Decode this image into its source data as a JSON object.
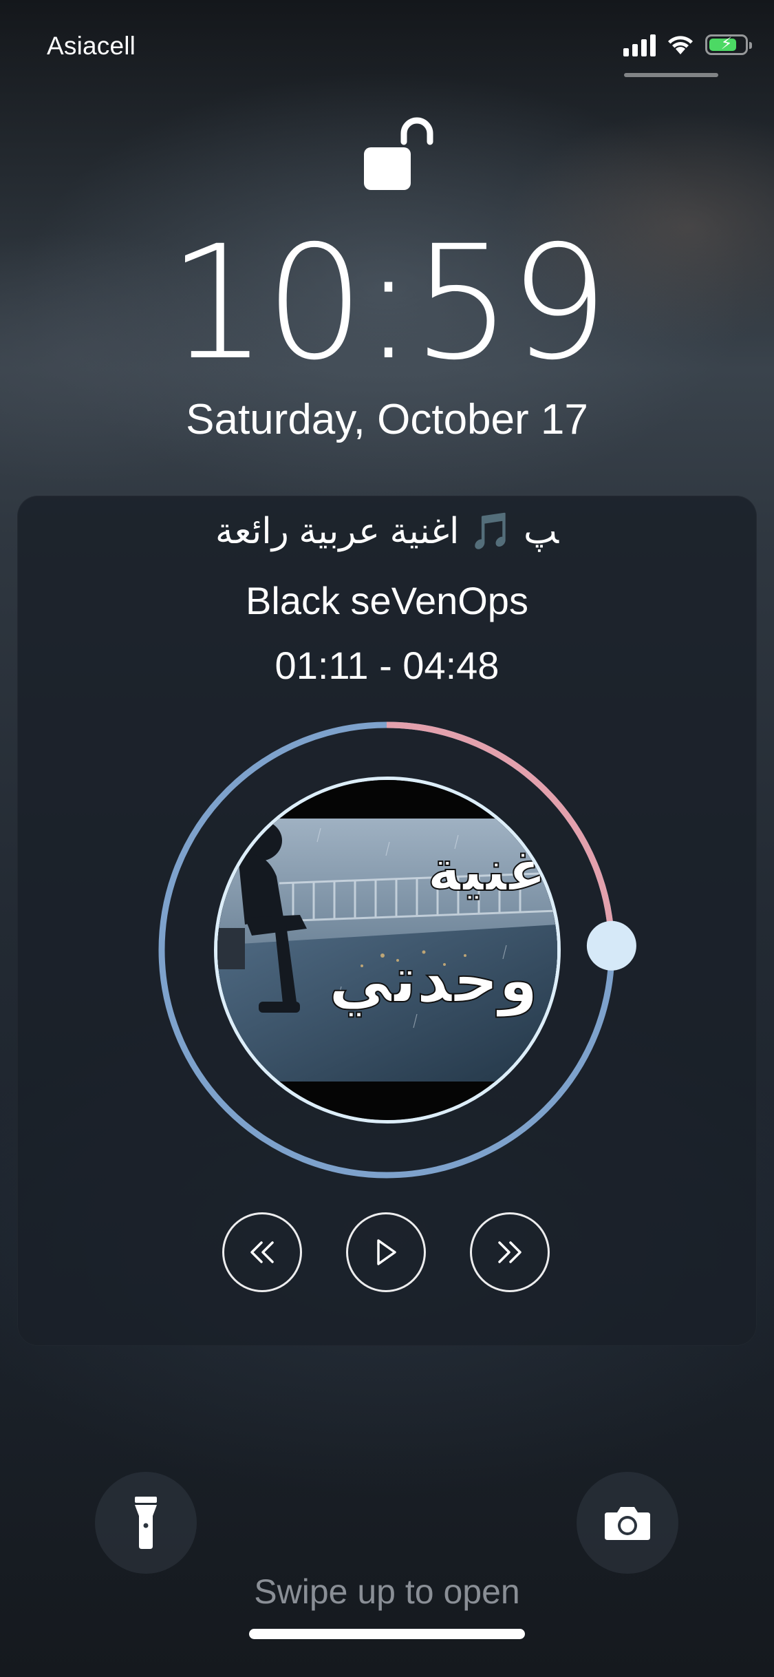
{
  "status_bar": {
    "carrier": "Asiacell",
    "signal_icon": "cellular-signal-icon",
    "wifi_icon": "wifi-icon",
    "battery_icon": "battery-charging-icon",
    "battery_level": 0.78,
    "battery_color": "#4cd964"
  },
  "lock_screen": {
    "lock_icon": "unlocked-padlock-icon",
    "time": "10:59",
    "date": "Saturday, October 17"
  },
  "now_playing": {
    "title": "ﭗ 🎵 اغنية عربية رائعة",
    "artist": "Black seVenOps",
    "elapsed": "01:11",
    "duration": "04:48",
    "times_display": "01:11 - 04:48",
    "progress_fraction": 0.247,
    "ring_color": "#7ea2cc",
    "progress_color": "#e3a1ad",
    "knob_color": "#d6e9f8",
    "art_text_line1": "غنية",
    "art_text_line2": "وحدتي",
    "controls": {
      "rewind_icon": "rewind-icon",
      "play_icon": "play-icon",
      "forward_icon": "fast-forward-icon"
    }
  },
  "bottom": {
    "flashlight_icon": "flashlight-icon",
    "camera_icon": "camera-icon",
    "swipe_hint": "Swipe up to open"
  }
}
